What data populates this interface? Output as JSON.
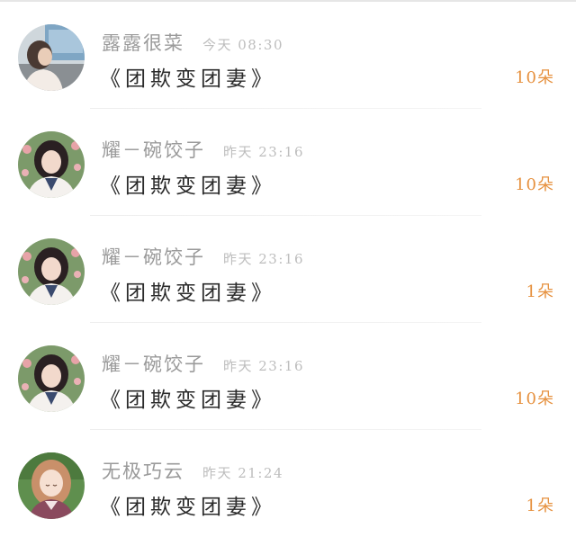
{
  "comments": [
    {
      "avatar": "avatar-girl-train-window",
      "username": "露露很菜",
      "time": "今天 08:30",
      "message": "《团欺变团妻》",
      "count": "10朵"
    },
    {
      "avatar": "avatar-girl-flowers",
      "username": "耀－碗饺子",
      "time": "昨天 23:16",
      "message": "《团欺变团妻》",
      "count": "10朵"
    },
    {
      "avatar": "avatar-girl-flowers",
      "username": "耀－碗饺子",
      "time": "昨天 23:16",
      "message": "《团欺变团妻》",
      "count": "1朵"
    },
    {
      "avatar": "avatar-girl-flowers",
      "username": "耀－碗饺子",
      "time": "昨天 23:16",
      "message": "《团欺变团妻》",
      "count": "10朵"
    },
    {
      "avatar": "avatar-anime-girl",
      "username": "无极巧云",
      "time": "昨天 21:24",
      "message": "《团欺变团妻》",
      "count": "1朵"
    }
  ],
  "colors": {
    "username": "#9a9a9a",
    "time": "#bdbdbd",
    "message": "#2b2b2b",
    "count": "#e6913f"
  }
}
